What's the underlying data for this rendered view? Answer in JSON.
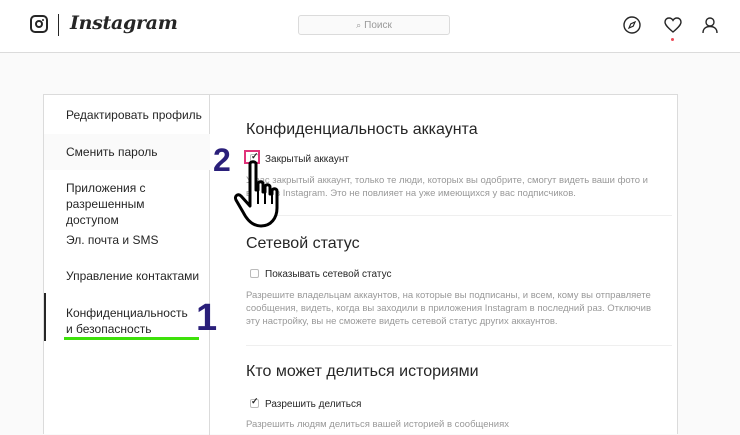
{
  "header": {
    "brand": "Instagram",
    "search_placeholder": "Поиск",
    "icons": [
      "explore-compass-icon",
      "activity-heart-icon",
      "profile-person-icon"
    ],
    "notification_dot_color": "#ed4956"
  },
  "sidebar": {
    "items": [
      {
        "label": "Редактировать профиль"
      },
      {
        "label": "Сменить пароль"
      },
      {
        "label": "Приложения с разрешенным доступом"
      },
      {
        "label": "Эл. почта и SMS"
      },
      {
        "label": "Управление контактами"
      },
      {
        "label": "Конфиденциальность и безопасность"
      }
    ],
    "active_index": 5
  },
  "sections": {
    "privacy": {
      "title": "Конфиденциальность аккаунта",
      "checkbox_label": "Закрытый аккаунт",
      "checked": true,
      "description": "У вас закрытый аккаунт, только те люди, которых вы одобрите, смогут видеть ваши фото и видео в Instagram. Это не повлияет на уже имеющихся у вас подписчиков."
    },
    "activity": {
      "title": "Сетевой статус",
      "checkbox_label": "Показывать сетевой статус",
      "checked": false,
      "description": "Разрешите владельцам аккаунтов, на которые вы подписаны, и всем, кому вы отправляете сообщения, видеть, когда вы заходили в приложения Instagram в последний раз. Отключив эту настройку, вы не сможете видеть сетевой статус других аккаунтов."
    },
    "story_sharing": {
      "title": "Кто может делиться историями",
      "checkbox_label": "Разрешить делиться",
      "checked": true,
      "description": "Разрешить людям делиться вашей историей в сообщениях"
    }
  },
  "annotations": {
    "step1": "1",
    "step2": "2",
    "underline_color": "#3ee10a",
    "highlight_color": "#e0337a",
    "number_color": "#2a1f7a"
  }
}
